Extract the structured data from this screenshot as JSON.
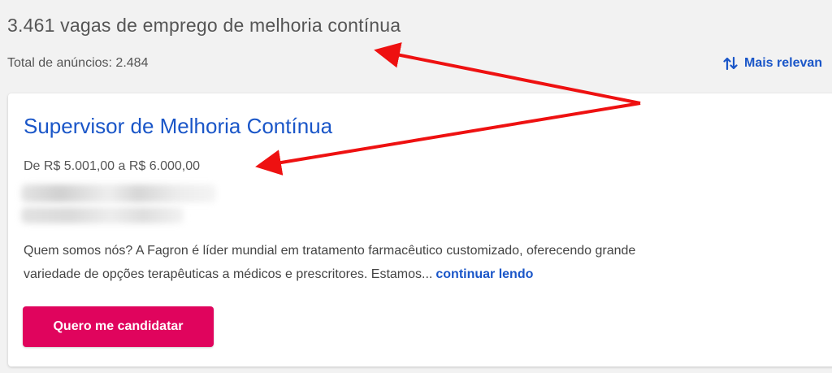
{
  "results": {
    "headline": "3.461 vagas de emprego de melhoria contínua",
    "total_label": "Total de anúncios: 2.484"
  },
  "sort": {
    "label": "Mais relevan",
    "icon": "sort-arrows-icon"
  },
  "job": {
    "title": "Supervisor de Melhoria Contínua",
    "salary": "De R$ 5.001,00 a R$ 6.000,00",
    "description_line1": "Quem somos nós? A Fagron é líder mundial em tratamento farmacêutico customizado, oferecendo grande",
    "description_line2": "variedade de opções terapêuticas a médicos e prescritores. Estamos...",
    "continue_label": "continuar lendo",
    "apply_label": "Quero me candidatar"
  },
  "colors": {
    "link_blue": "#1a56c8",
    "apply_pink": "#e0045d",
    "annotation_red": "#ee1111",
    "page_background": "#f2f2f2"
  }
}
